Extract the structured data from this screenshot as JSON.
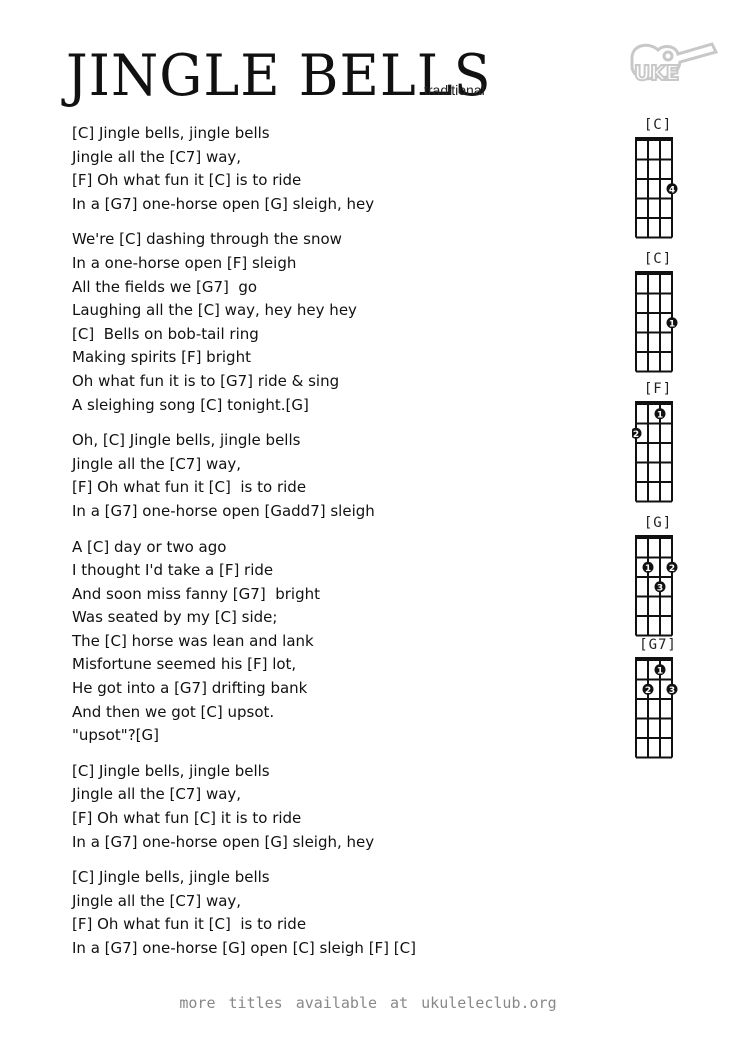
{
  "header": {
    "title": "JINGLE BELLS",
    "subtitle": "traditional",
    "logo_text": "UKE",
    "logo_icon": "ukulele-logo-icon"
  },
  "verses": [
    {
      "lines": [
        "[C] Jingle bells, jingle bells",
        "Jingle all the [C7] way,",
        "[F] Oh what fun it [C] is to ride",
        "In a [G7] one-horse open [G] sleigh, hey"
      ]
    },
    {
      "lines": [
        "We're [C] dashing through the snow",
        "In a one-horse open [F] sleigh",
        "All the fields we [G7]  go",
        "Laughing all the [C] way, hey hey hey",
        "[C]  Bells on bob-tail ring",
        "Making spirits [F] bright",
        "Oh what fun it is to [G7] ride & sing",
        "A sleighing song [C] tonight.[G]"
      ]
    },
    {
      "lines": [
        "Oh, [C] Jingle bells, jingle bells",
        "Jingle all the [C7] way,",
        "[F] Oh what fun it [C]  is to ride",
        "In a [G7] one-horse open [Gadd7] sleigh"
      ]
    },
    {
      "lines": [
        "A [C] day or two ago",
        "I thought I'd take a [F] ride",
        "And soon miss fanny [G7]  bright",
        "Was seated by my [C] side;",
        "The [C] horse was lean and lank",
        "Misfortune seemed his [F] lot,",
        "He got into a [G7] drifting bank",
        "And then we got [C] upsot.",
        "\"upsot\"?[G]"
      ]
    },
    {
      "lines": [
        "[C] Jingle bells, jingle bells",
        "Jingle all the [C7] way,",
        "[F] Oh what fun [C] it is to ride",
        "In a [G7] one-horse open [G] sleigh, hey"
      ]
    },
    {
      "lines": [
        "[C] Jingle bells, jingle bells",
        "Jingle all the [C7] way,",
        "[F] Oh what fun it [C]  is to ride",
        "In a [G7] one-horse [G] open [C] sleigh [F] [C]"
      ]
    }
  ],
  "chords": [
    {
      "name": "[C]",
      "dots": [
        {
          "string": 4,
          "fret": 3,
          "finger": "4"
        }
      ]
    },
    {
      "name": "[C]",
      "dots": [
        {
          "string": 4,
          "fret": 3,
          "finger": "1"
        }
      ]
    },
    {
      "name": "[F]",
      "dots": [
        {
          "string": 3,
          "fret": 1,
          "finger": "1"
        },
        {
          "string": 1,
          "fret": 2,
          "finger": "2"
        }
      ]
    },
    {
      "name": "[G]",
      "dots": [
        {
          "string": 2,
          "fret": 2,
          "finger": "1"
        },
        {
          "string": 4,
          "fret": 2,
          "finger": "2"
        },
        {
          "string": 3,
          "fret": 3,
          "finger": "3"
        }
      ]
    },
    {
      "name": "[G7]",
      "dots": [
        {
          "string": 3,
          "fret": 1,
          "finger": "1"
        },
        {
          "string": 2,
          "fret": 2,
          "finger": "2"
        },
        {
          "string": 4,
          "fret": 2,
          "finger": "3"
        }
      ]
    }
  ],
  "footer": {
    "text": "more titles available at ukuleleclub.org"
  }
}
